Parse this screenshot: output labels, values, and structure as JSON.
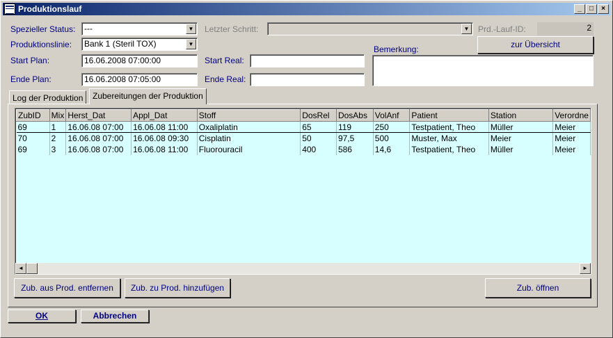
{
  "window": {
    "title": "Produktionslauf",
    "min": "_",
    "max": "□",
    "close": "×"
  },
  "form": {
    "spezieller_status": {
      "label": "Spezieller Status:",
      "value": "---"
    },
    "letzter_schritt": {
      "label": "Letzter Schritt:",
      "value": ""
    },
    "prd_lauf_id": {
      "label": "Prd.-Lauf-ID:",
      "value": "2"
    },
    "produktionslinie": {
      "label": "Produktionslinie:",
      "value": "Bank 1 (Steril TOX)"
    },
    "start_plan": {
      "label": "Start Plan:",
      "value": "16.06.2008 07:00:00"
    },
    "start_real": {
      "label": "Start Real:",
      "value": ""
    },
    "ende_plan": {
      "label": "Ende Plan:",
      "value": "16.06.2008 07:05:00"
    },
    "ende_real": {
      "label": "Ende Real:",
      "value": ""
    },
    "bemerkung": {
      "label": "Bemerkung:",
      "value": ""
    },
    "zur_uebersicht": "zur Übersicht"
  },
  "tabs": [
    {
      "label": "Log der Produktion"
    },
    {
      "label": "Zubereitungen der Produktion"
    }
  ],
  "grid": {
    "columns": [
      "ZubID",
      "Mix",
      "Herst_Dat",
      "Appl_Dat",
      "Stoff",
      "DosRel",
      "DosAbs",
      "VolAnf",
      "Patient",
      "Station",
      "Verordne"
    ],
    "rows": [
      [
        "69",
        "1",
        "16.06.08 07:00",
        "16.06.08 11:00",
        "Oxaliplatin",
        "65",
        "119",
        "250",
        "Testpatient, Theo",
        "Müller",
        "Meier"
      ],
      [
        "70",
        "2",
        "16.06.08 07:00",
        "16.06.08 09:30",
        "Cisplatin",
        "50",
        "97,5",
        "500",
        "Muster, Max",
        "Meier",
        "Meier"
      ],
      [
        "69",
        "3",
        "16.06.08 07:00",
        "16.06.08 11:00",
        "Fluorouracil",
        "400",
        "586",
        "14,6",
        "Testpatient, Theo",
        "Müller",
        "Meier"
      ]
    ]
  },
  "buttons": {
    "remove": "Zub. aus Prod. entfernen",
    "add": "Zub. zu Prod. hinzufügen",
    "open": "Zub. öffnen",
    "ok": "OK",
    "cancel": "Abbrechen"
  }
}
